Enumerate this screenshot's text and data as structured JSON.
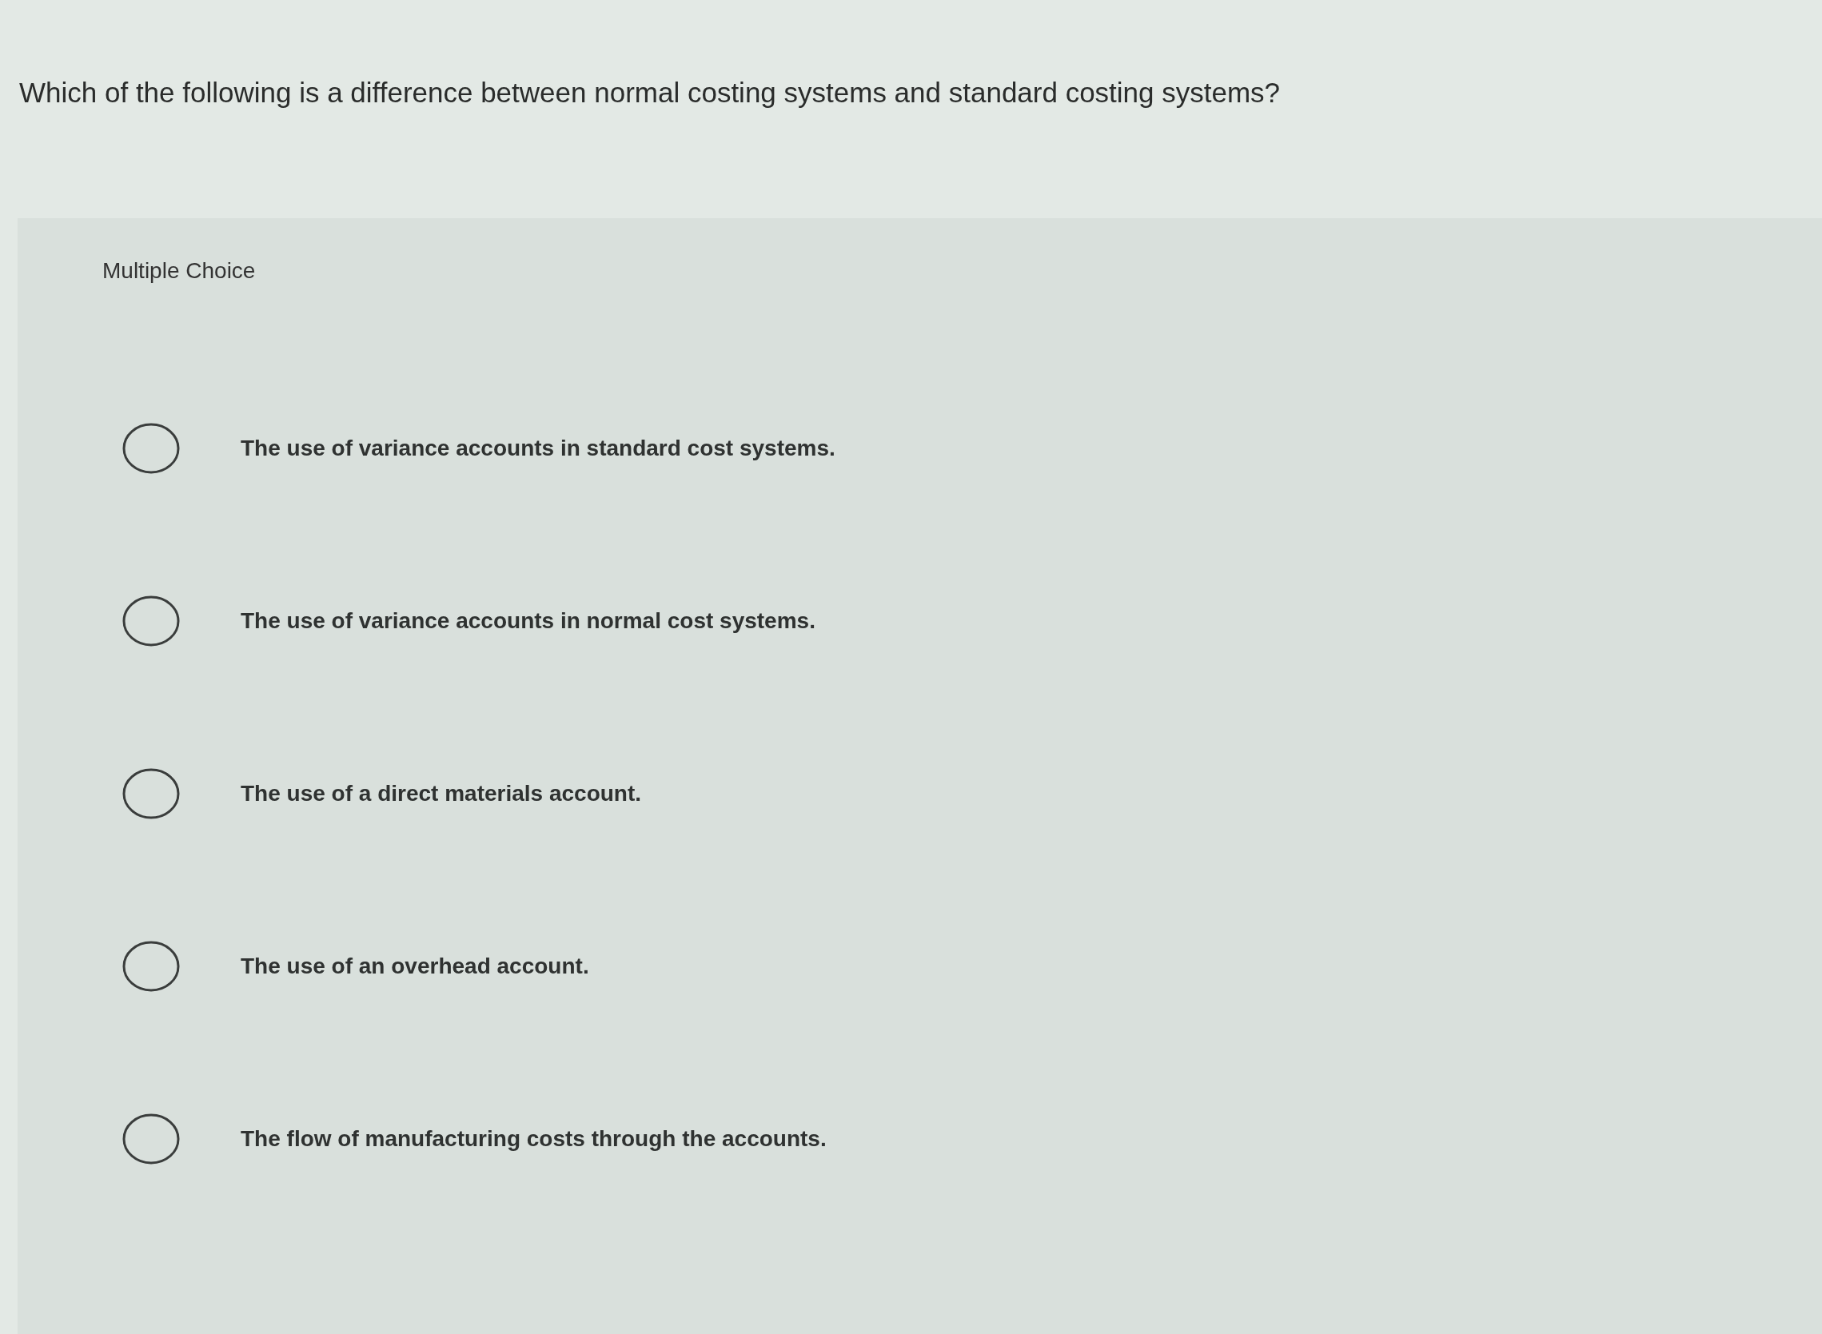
{
  "question": "Which of the following is a difference between normal costing systems and standard costing systems?",
  "section_label": "Multiple Choice",
  "options": [
    {
      "text": "The use of variance accounts in standard cost systems.",
      "selected": false
    },
    {
      "text": "The use of variance accounts in normal cost systems.",
      "selected": false
    },
    {
      "text": "The use of a direct materials account.",
      "selected": false
    },
    {
      "text": "The use of an overhead account.",
      "selected": false
    },
    {
      "text": "The flow of manufacturing costs through the accounts.",
      "selected": false
    }
  ]
}
